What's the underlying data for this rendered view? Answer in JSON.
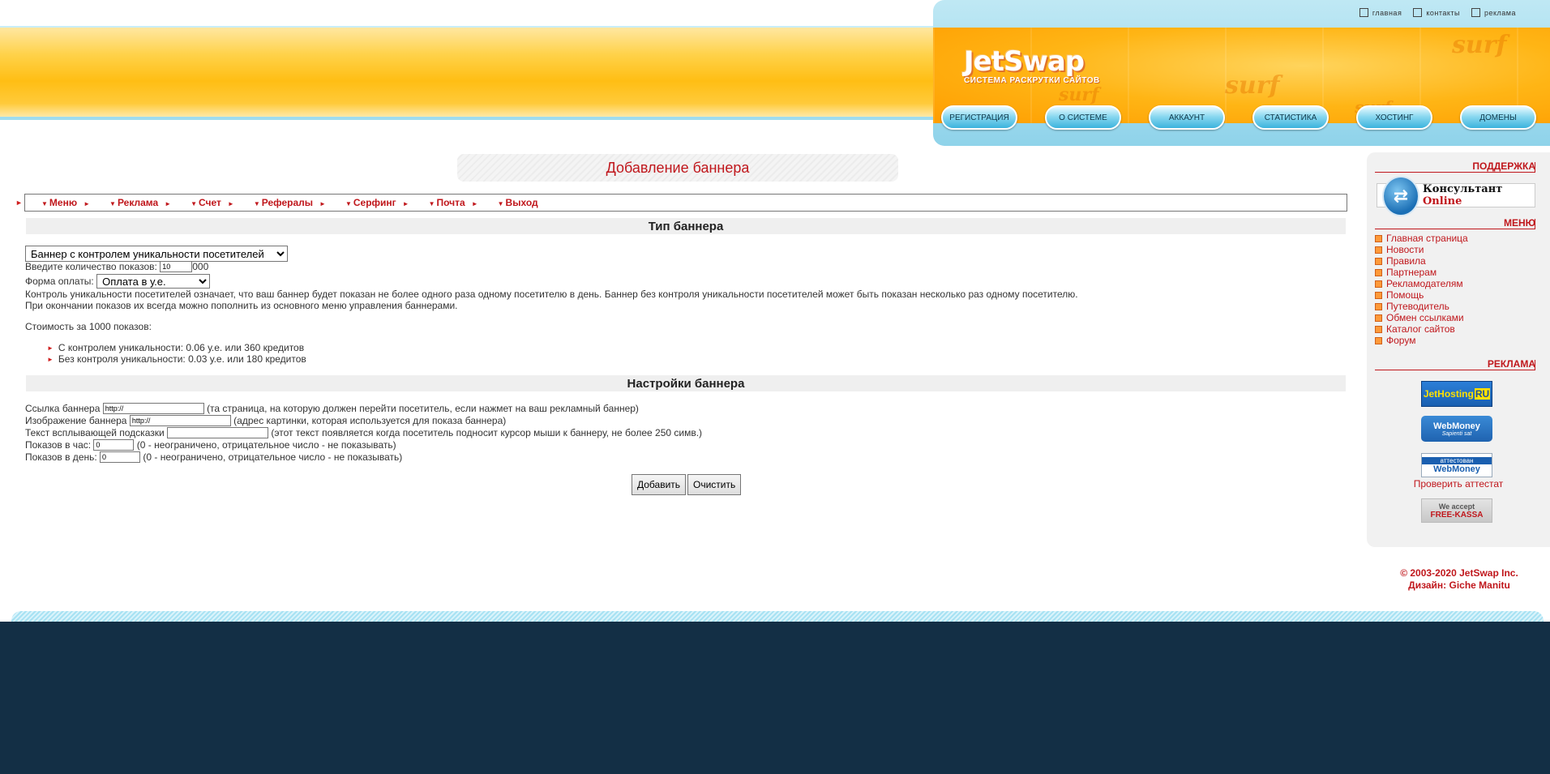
{
  "header": {
    "logo": "JetSwap",
    "logo_sub": "СИСТЕМА РАСКРУТКИ САЙТОВ",
    "top_links": [
      {
        "label": "главная",
        "icon": "home-icon"
      },
      {
        "label": "контакты",
        "icon": "mail-icon"
      },
      {
        "label": "реклама",
        "icon": "heart-icon"
      }
    ],
    "nav": [
      "РЕГИСТРАЦИЯ",
      "О СИСТЕМЕ",
      "АККАУНТ",
      "СТАТИСТИКА",
      "ХОСТИНГ",
      "ДОМЕНЫ"
    ]
  },
  "main": {
    "page_title": "Добавление баннера",
    "menu": [
      "Меню",
      "Реклама",
      "Счет",
      "Рефералы",
      "Серфинг",
      "Почта",
      "Выход"
    ],
    "banner_type": {
      "heading": "Тип баннера",
      "select_value": "Баннер с контролем уникальности посетителей",
      "shows_label": "Введите количество показов:",
      "shows_value": "10",
      "shows_suffix": "000",
      "payment_label": "Форма оплаты:",
      "payment_value": "Оплата в у.е.",
      "info_line1": "Контроль уникальности посетителей означает, что ваш баннер будет показан не более одного раза одному посетителю в день. Баннер без контроля уникальности посетителей может быть показан несколько раз одному посетителю.",
      "info_line2": "При окончании показов их всегда можно пополнить из основного меню управления баннерами.",
      "cost_label": "Стоимость за 1000 показов:",
      "cost_items": [
        "С контролем уникальности: 0.06 у.е. или 360 кредитов",
        "Без контроля уникальности: 0.03 у.е. или 180 кредитов"
      ]
    },
    "banner_settings": {
      "heading": "Настройки баннера",
      "link_label": "Ссылка баннера",
      "link_value": "http://",
      "link_hint": "(та страница, на которую должен перейти посетитель, если нажмет на ваш рекламный баннер)",
      "image_label": "Изображение баннера",
      "image_value": "http://",
      "image_hint": "(адрес картинки, которая используется для показа баннера)",
      "tooltip_label": "Текст всплывающей подсказки",
      "tooltip_value": "",
      "tooltip_hint": "(этот текст появляется когда посетитель подносит курсор мыши к баннеру, не более 250 симв.)",
      "per_hour_label": "Показов в час:",
      "per_hour_value": "0",
      "per_hour_hint": "(0 - неограничено, отрицательное число - не показывать)",
      "per_day_label": "Показов в день:",
      "per_day_value": "0",
      "per_day_hint": "(0 - неограничено, отрицательное число - не показывать)"
    },
    "buttons": {
      "add": "Добавить",
      "clear": "Очистить"
    }
  },
  "sidebar": {
    "support_heading": "Поддержка",
    "consultant": "Консультант",
    "consultant_online": "Online",
    "menu_heading": "МЕНЮ",
    "menu_items": [
      "Главная страница",
      "Новости",
      "Правила",
      "Партнерам",
      "Рекламодателям",
      "Помощь",
      "Путеводитель",
      "Обмен ссылками",
      "Каталог сайтов",
      "Форум"
    ],
    "ads_heading": "РЕКЛАМА",
    "ad_jethosting": "JetHosting",
    "ad_jethosting_suffix": "RU",
    "ad_webmoney": "WebMoney",
    "ad_webmoney_sub": "Sapienti sat",
    "ad_attested": "аттестован",
    "ad_attested_brand": "WebMoney",
    "check_attestat": "Проверить аттестат",
    "ad_freekassa_top": "We accept",
    "ad_freekassa": "FREE-KASSA"
  },
  "footer": {
    "copyright": "© 2003-2020 JetSwap Inc.",
    "design": "Дизайн: Giche Manitu"
  },
  "colors": {
    "accent": "#c0171c",
    "footer_bg": "#132f45",
    "header_orange": "#ffbe14",
    "nav_blue": "#3cb3dd"
  }
}
